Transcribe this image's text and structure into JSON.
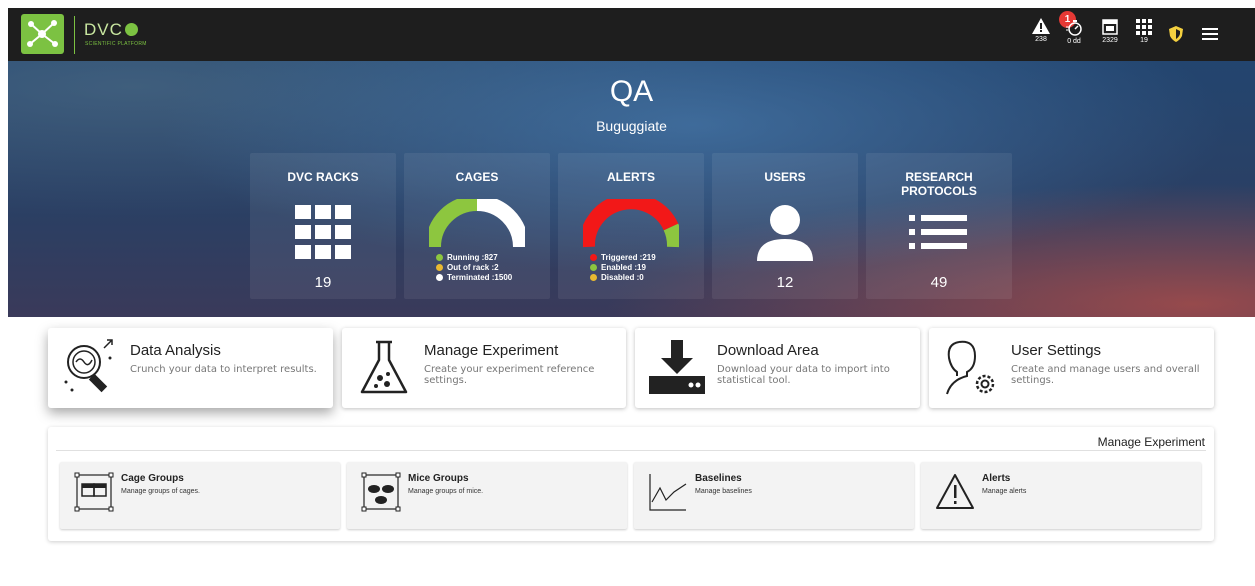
{
  "header": {
    "brand": "DVC",
    "brand_sub": "SCIENTIFIC PLATFORM",
    "alerts_badge": "1",
    "alerts_value": "238",
    "timer_value": "0 dd",
    "cages_value": "2329",
    "racks_value": "19",
    "icons": [
      "logo-icon",
      "warning-icon",
      "stopwatch-icon",
      "cage-icon",
      "grid-icon",
      "shield-icon",
      "menu-icon"
    ]
  },
  "hero": {
    "title": "QA",
    "subtitle": "Buguggiate",
    "stats": {
      "racks": {
        "title": "DVC RACKS",
        "value": "19"
      },
      "cages": {
        "title": "CAGES",
        "legend": [
          "Running :827",
          "Out of rack :2",
          "Terminated :1500"
        ]
      },
      "alerts": {
        "title": "ALERTS",
        "legend": [
          "Triggered :219",
          "Enabled :19",
          "Disabled :0"
        ]
      },
      "users": {
        "title": "USERS",
        "value": "12"
      },
      "protocols": {
        "title": "RESEARCH PROTOCOLS",
        "value": "49"
      }
    }
  },
  "cards": [
    {
      "title": "Data Analysis",
      "desc": "Crunch your data to interpret results."
    },
    {
      "title": "Manage Experiment",
      "desc": "Create your experiment reference settings."
    },
    {
      "title": "Download Area",
      "desc": "Download your data to import into statistical tool."
    },
    {
      "title": "User Settings",
      "desc": "Create and manage users and overall settings."
    }
  ],
  "section": {
    "title": "Manage Experiment",
    "items": [
      {
        "title": "Cage Groups",
        "desc": "Manage groups of cages."
      },
      {
        "title": "Mice Groups",
        "desc": "Manage groups of mice."
      },
      {
        "title": "Baselines",
        "desc": "Manage baselines"
      },
      {
        "title": "Alerts",
        "desc": "Manage alerts"
      }
    ]
  },
  "colors": {
    "brand_green": "#7cc242",
    "alert_red": "#e53935",
    "gauge_green": "#8dc63f",
    "gauge_yellow": "#e8b931",
    "gauge_white": "#ffffff",
    "gauge_red": "#f21818"
  }
}
